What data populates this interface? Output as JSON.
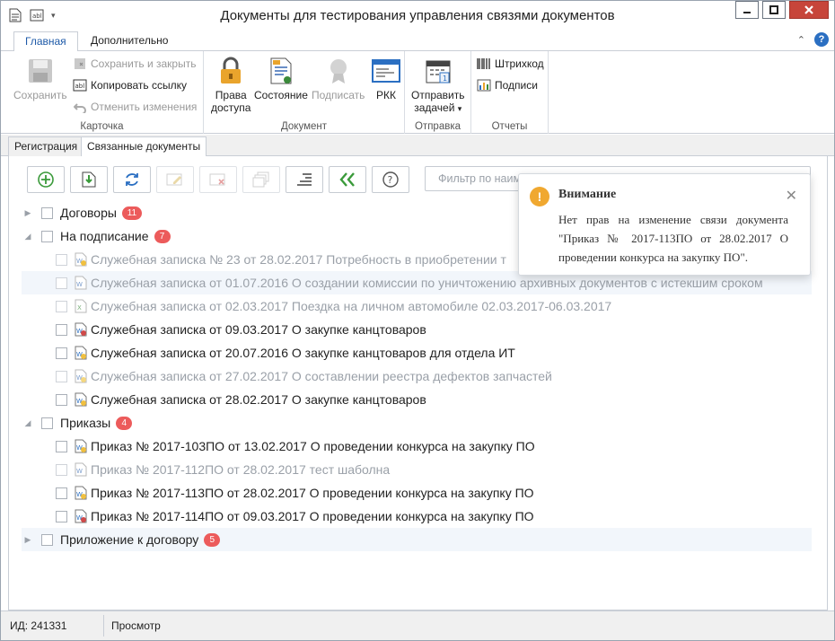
{
  "window": {
    "title": "Документы для тестирования управления связями документов"
  },
  "ribbon_tabs": [
    "Главная",
    "Дополнительно"
  ],
  "ribbon": {
    "card_group": {
      "label": "Карточка",
      "save": "Сохранить",
      "save_close": "Сохранить и закрыть",
      "copy_link": "Копировать ссылку",
      "undo": "Отменить изменения"
    },
    "document_group": {
      "label": "Документ",
      "access_line1": "Права",
      "access_line2": "доступа",
      "state": "Состояние",
      "sign": "Подписать",
      "rkk": "РКК"
    },
    "send_group": {
      "label": "Отправка",
      "send_line1": "Отправить",
      "send_line2": "задачей"
    },
    "reports_group": {
      "label": "Отчеты",
      "barcode": "Штрихкод",
      "signatures": "Подписи"
    }
  },
  "doc_tabs": [
    "Регистрация",
    "Связанные документы"
  ],
  "filter": {
    "placeholder": "Фильтр по наим"
  },
  "tree": {
    "categories": [
      {
        "label": "Договоры",
        "count": "11"
      },
      {
        "label": "На подписание",
        "count": "7"
      },
      {
        "label": "Приказы",
        "count": "4"
      },
      {
        "label": "Приложение к договору",
        "count": "5"
      }
    ],
    "on_sign": [
      {
        "label": "Служебная записка № 23 от 28.02.2017 Потребность в приобретении т"
      },
      {
        "label": "Служебная записка от 01.07.2016 О создании комиссии по уничтожению архивных документов с истекшим сроком"
      },
      {
        "label": "Служебная записка от 02.03.2017 Поездка на личном автомобиле 02.03.2017-06.03.2017"
      },
      {
        "label": "Служебная записка от 09.03.2017 О закупке канцтоваров"
      },
      {
        "label": "Служебная записка от 20.07.2016 О закупке канцтоваров для отдела ИТ"
      },
      {
        "label": "Служебная записка от 27.02.2017 О составлении реестра дефектов запчастей"
      },
      {
        "label": "Служебная записка от 28.02.2017 О закупке канцтоваров"
      }
    ],
    "orders": [
      {
        "label": "Приказ № 2017-103ПО от 13.02.2017 О проведении конкурса на закупку ПО"
      },
      {
        "label": "Приказ № 2017-112ПО от 28.02.2017 тест шаболна"
      },
      {
        "label": "Приказ № 2017-113ПО от 28.02.2017 О проведении конкурса на закупку ПО"
      },
      {
        "label": "Приказ № 2017-114ПО от 09.03.2017 О проведении конкурса на закупку ПО"
      }
    ]
  },
  "popup": {
    "title": "Внимание",
    "message": "Нет прав на изменение связи документа \"Приказ № 2017-113ПО от 28.02.2017 О проведении конкурса на закупку ПО\"."
  },
  "status": {
    "id": "ИД: 241331",
    "mode": "Просмотр"
  },
  "colors": {
    "accent": "#1e5aa8",
    "badge": "#ec5b5b",
    "warning": "#f0a830",
    "close_button": "#c7453a"
  }
}
